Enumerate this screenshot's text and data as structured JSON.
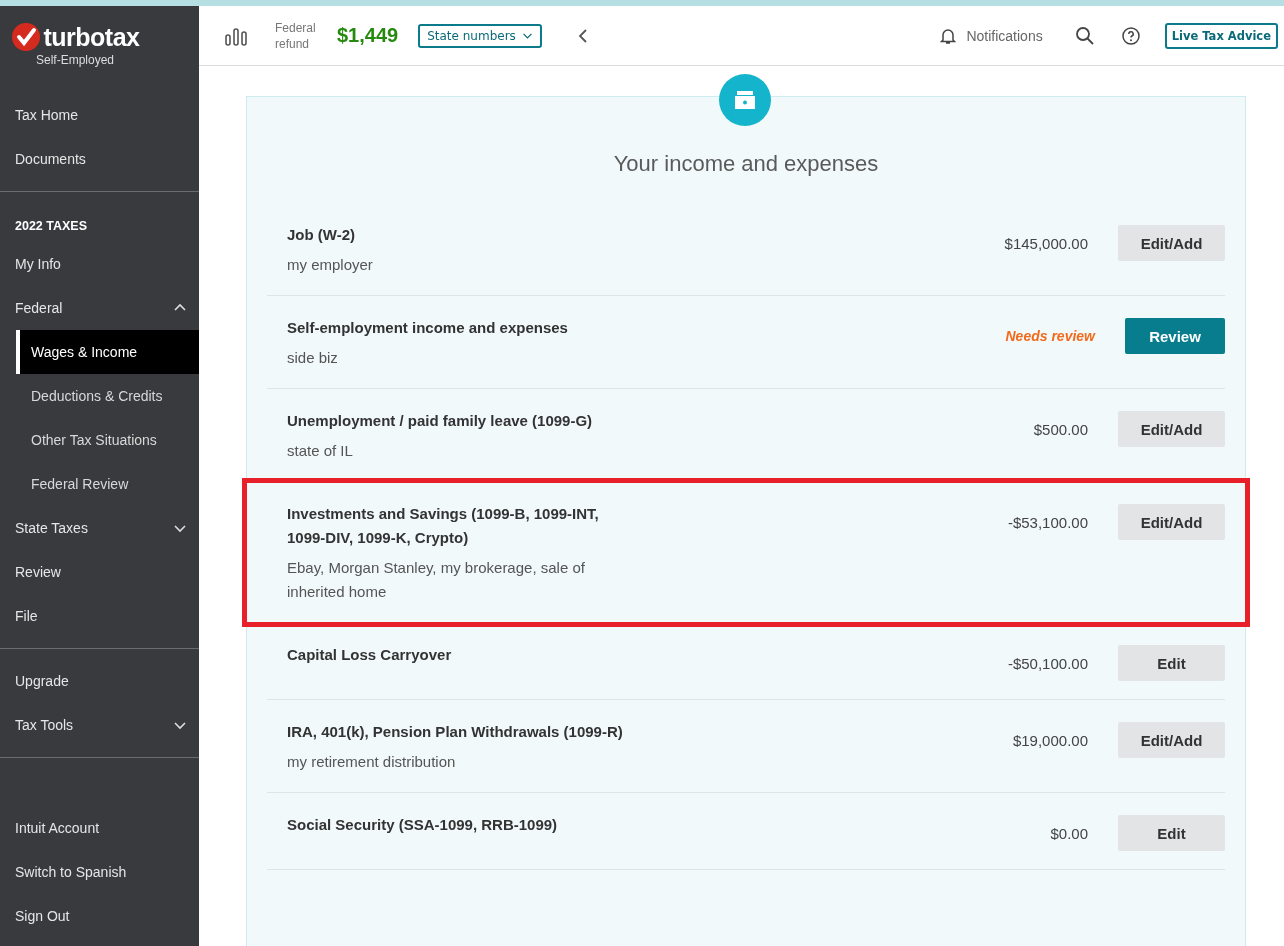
{
  "brand": {
    "name": "turbotax",
    "edition": "Self-Employed"
  },
  "sidebar": {
    "groups": [
      [
        {
          "label": "Tax Home",
          "kind": "link",
          "selected": false
        },
        {
          "label": "Documents",
          "kind": "link",
          "selected": false
        }
      ],
      [
        {
          "label": "2022 TAXES",
          "kind": "heading"
        },
        {
          "label": "My Info",
          "kind": "link",
          "selected": false
        },
        {
          "label": "Federal",
          "kind": "link",
          "selected": false,
          "expanded": true,
          "children": [
            {
              "label": "Wages & Income",
              "kind": "sub",
              "selected": true
            },
            {
              "label": "Deductions & Credits",
              "kind": "sub",
              "selected": false
            },
            {
              "label": "Other Tax Situations",
              "kind": "sub",
              "selected": false
            },
            {
              "label": "Federal Review",
              "kind": "sub",
              "selected": false
            }
          ]
        },
        {
          "label": "State Taxes",
          "kind": "link",
          "selected": false,
          "expanded": false
        },
        {
          "label": "Review",
          "kind": "link",
          "selected": false
        },
        {
          "label": "File",
          "kind": "link",
          "selected": false
        }
      ],
      [
        {
          "label": "Upgrade",
          "kind": "link",
          "selected": false
        },
        {
          "label": "Tax Tools",
          "kind": "link",
          "selected": false,
          "expanded": false
        }
      ]
    ],
    "footer": [
      {
        "label": "Intuit Account"
      },
      {
        "label": "Switch to Spanish"
      },
      {
        "label": "Sign Out"
      }
    ]
  },
  "header": {
    "refund_label": "Federal refund",
    "refund_amount": "$1,449",
    "state_button": "State numbers",
    "notifications": "Notifications",
    "live_advice": "Live Tax Advice"
  },
  "panel": {
    "title": "Your income and expenses",
    "rows": [
      {
        "title": "Job (W-2)",
        "subtitle": "my employer",
        "amount": "$145,000.00",
        "button": "Edit/Add",
        "kind": "secondary",
        "highlighted": false
      },
      {
        "title": "Self-employment income and expenses",
        "subtitle": "side biz",
        "status": "Needs review",
        "button": "Review",
        "kind": "primary",
        "highlighted": false
      },
      {
        "title": "Unemployment / paid family leave (1099-G)",
        "subtitle": "state of IL",
        "amount": "$500.00",
        "button": "Edit/Add",
        "kind": "secondary",
        "highlighted": false
      },
      {
        "title": "Investments and Savings (1099-B, 1099-INT, 1099-DIV, 1099-K, Crypto)",
        "subtitle": "Ebay, Morgan Stanley, my brokerage, sale of inherited home",
        "amount": "-$53,100.00",
        "button": "Edit/Add",
        "kind": "secondary",
        "highlighted": true
      },
      {
        "title": "Capital Loss Carryover",
        "amount": "-$50,100.00",
        "button": "Edit",
        "kind": "secondary",
        "highlighted": false
      },
      {
        "title": "IRA, 401(k), Pension Plan Withdrawals (1099-R)",
        "subtitle": "my retirement distribution",
        "amount": "$19,000.00",
        "button": "Edit/Add",
        "kind": "secondary",
        "highlighted": false
      },
      {
        "title": "Social Security (SSA-1099, RRB-1099)",
        "amount": "$0.00",
        "button": "Edit",
        "kind": "secondary",
        "highlighted": false
      }
    ]
  }
}
